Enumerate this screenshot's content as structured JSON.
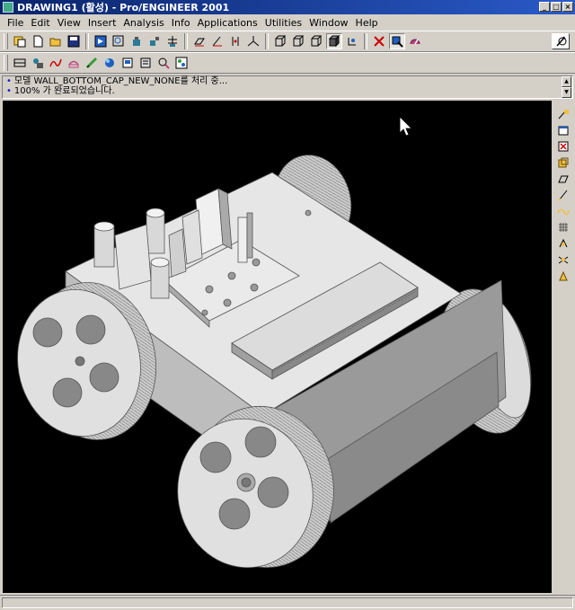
{
  "window": {
    "title": "DRAWING1 (활성) - Pro/ENGINEER 2001",
    "minimize": "_",
    "maximize": "□",
    "close": "×"
  },
  "menu": [
    "File",
    "Edit",
    "View",
    "Insert",
    "Analysis",
    "Info",
    "Applications",
    "Utilities",
    "Window",
    "Help"
  ],
  "toolbar1_icons": [
    "new-window-icon",
    "new-file-icon",
    "open-file-icon",
    "save-icon",
    "repaint-icon",
    "zoom-in-icon",
    "orient-icon",
    "model-tree-icon",
    "layer-icon",
    "datum-plane-icon",
    "datum-axis-icon",
    "datum-point-icon",
    "coordinate-system-icon",
    "wireframe-icon",
    "hidden-line-icon",
    "no-hidden-icon",
    "shaded-icon",
    "spin-center-icon",
    "select-icon",
    "query-select-icon",
    "help-icon"
  ],
  "toolbar2_icons": [
    "relations-icon",
    "parameters-icon",
    "curve-icon",
    "surface-icon",
    "measure-icon",
    "mass-icon",
    "section-icon",
    "model-info-icon",
    "search-icon",
    "environment-icon"
  ],
  "messages": [
    {
      "bullet": "•",
      "text": "모델 WALL_BOTTOM_CAP_NEW_NONE를 처리 중..."
    },
    {
      "bullet": "•",
      "text": "100% 가 완료되었습니다."
    }
  ],
  "right_toolbar_icons": [
    "sketch-icon",
    "view-icon",
    "delete-icon",
    "copy-icon",
    "plane-icon",
    "line-icon",
    "spline-icon",
    "grid-icon",
    "snap-icon",
    "dimension-icon",
    "note-icon"
  ],
  "colors": {
    "chrome": "#d4d0c8",
    "titlebar": "#0a246a",
    "viewport": "#000000",
    "model": "#d8d8d8"
  }
}
